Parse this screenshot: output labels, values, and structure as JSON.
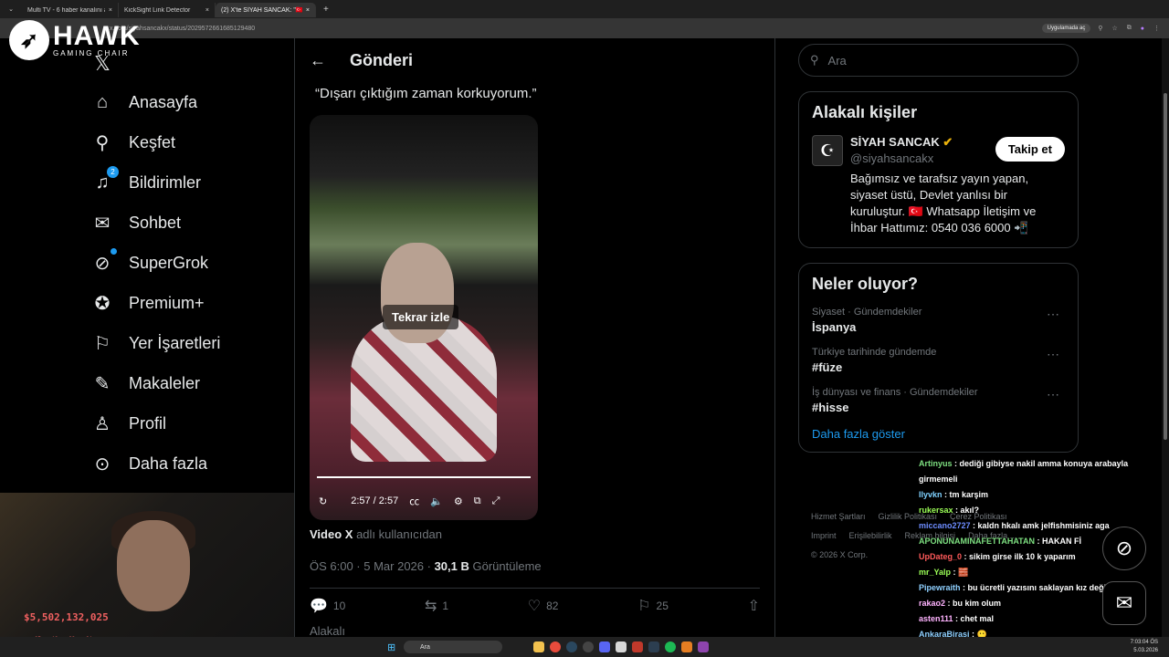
{
  "browser": {
    "tabs": [
      {
        "label": "Multi TV - 6 haber kanalını aynı"
      },
      {
        "label": "KickSight Link Detector"
      },
      {
        "label": "(2) X'te SİYAH SANCAK: \"🇹🇷 2"
      }
    ],
    "url": "x.com/siyahsancakx/status/2029572661685129480",
    "app_button": "Uygulamada aç"
  },
  "overlay": {
    "brand": "HAWK",
    "brand_sub": "GAMING CHAIR",
    "money": "$5,502,132,025",
    "stats": [
      "05",
      "12",
      "03",
      "04"
    ]
  },
  "nav": {
    "items": [
      {
        "label": "Anasayfa",
        "icon": "home-icon",
        "glyph": "⌂"
      },
      {
        "label": "Keşfet",
        "icon": "search-icon",
        "glyph": "⚲"
      },
      {
        "label": "Bildirimler",
        "icon": "bell-icon",
        "glyph": "🔔",
        "badge": "2"
      },
      {
        "label": "Sohbet",
        "icon": "mail-icon",
        "glyph": "✉"
      },
      {
        "label": "SuperGrok",
        "icon": "grok-icon",
        "glyph": "⊘"
      },
      {
        "label": "Premium+",
        "icon": "verified-icon",
        "glyph": "✪"
      },
      {
        "label": "Yer İşaretleri",
        "icon": "bookmark-icon",
        "glyph": "🔖"
      },
      {
        "label": "Makaleler",
        "icon": "article-icon",
        "glyph": "✎"
      },
      {
        "label": "Profil",
        "icon": "profile-icon",
        "glyph": "👤"
      },
      {
        "label": "Daha fazla",
        "icon": "more-icon",
        "glyph": "⋯"
      }
    ]
  },
  "post": {
    "header": "Gönderi",
    "quote": "“Dışarı çıktığım zaman korkuyorum.”",
    "video": {
      "replay": "Tekrar izle",
      "time": "2:57 / 2:57"
    },
    "via_label": "Video X",
    "via_text": " adlı kullanıcıdan",
    "timestamp": "ÖS 6:00 · 5 Mar 2026 · ",
    "views": "30,1 B",
    "views_label": " Görüntüleme",
    "actions": {
      "replies": "10",
      "reposts": "1",
      "likes": "82",
      "bookmarks": "25"
    },
    "related": "Alakalı"
  },
  "right": {
    "search_placeholder": "Ara",
    "people": {
      "title": "Alakalı kişiler",
      "name": "SİYAH SANCAK",
      "handle": "@siyahsancakx",
      "bio": "Bağımsız ve tarafsız yayın yapan, siyaset üstü, Devlet yanlısı bir kuruluştur. 🇹🇷 Whatsapp İletişim ve İhbar Hattımız: 0540 036 6000 📲",
      "follow": "Takip et"
    },
    "trends": {
      "title": "Neler oluyor?",
      "items": [
        {
          "category": "Siyaset · Gündemdekiler",
          "topic": "İspanya"
        },
        {
          "category": "Türkiye tarihinde gündemde",
          "topic": "#füze"
        },
        {
          "category": "İş dünyası ve finans · Gündemdekiler",
          "topic": "#hisse"
        }
      ],
      "show_more": "Daha fazla göster"
    },
    "footer": [
      "Hizmet Şartları",
      "Gizlilik Politikası",
      "Çerez Politikası",
      "Imprint",
      "Erişilebilirlik",
      "Reklam bilgisi",
      "Daha fazla ...",
      "© 2026 X Corp."
    ]
  },
  "chat": [
    {
      "user": "Artinyus",
      "color": "#7ee081",
      "msg": " : dediği gibiyse nakil amma konuya arabayla girmemeli"
    },
    {
      "user": "Ilyvkn",
      "color": "#7fd1ff",
      "msg": " : tm karşim"
    },
    {
      "user": "rukersax",
      "color": "#9cff57",
      "msg": " : akıl?"
    },
    {
      "user": "miccano2727",
      "color": "#6d8cff",
      "msg": " : kaldn hkalı amk jelfishmisiniz aga"
    },
    {
      "user": "APONUNAMINAFETTAHATAN",
      "color": "#7ee081",
      "msg": " : HAKAN Fİ"
    },
    {
      "user": "UpDateg_0",
      "color": "#ff5a5a",
      "msg": " : sikim girse ilk 10 k yaparım"
    },
    {
      "user": "mr_Yalp",
      "color": "#9cff57",
      "msg": " : 🧱"
    },
    {
      "user": "Pipewraith",
      "color": "#8fd0ff",
      "msg": " : bu ücretli yazısını saklayan kız değil mi ?"
    },
    {
      "user": "rakao2",
      "color": "#ffb3ff",
      "msg": " : bu kim olum"
    },
    {
      "user": "asten111",
      "color": "#ffb3ff",
      "msg": " : chet mal"
    },
    {
      "user": "AnkaraBirasi",
      "color": "#8fd0ff",
      "msg": " : 😶"
    }
  ],
  "taskbar": {
    "search": "Ara",
    "time": "7:03:04 ÖS",
    "date": "5.03.2026"
  }
}
